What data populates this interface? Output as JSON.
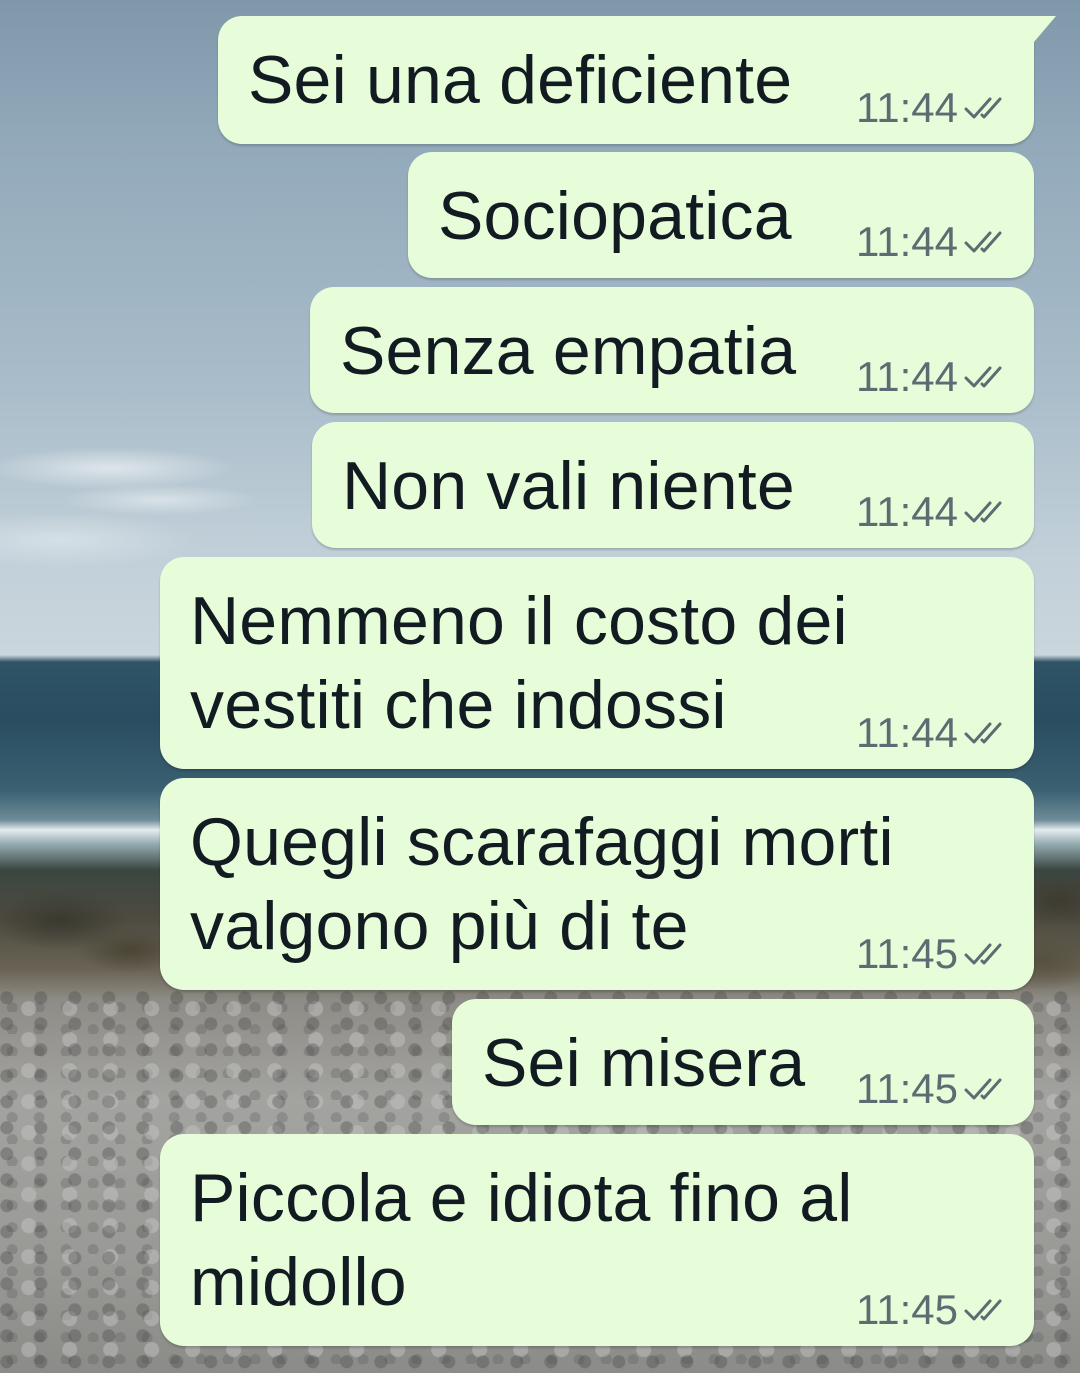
{
  "conversation": {
    "messages": [
      {
        "text": "Sei una deficiente",
        "time": "11:44",
        "status": "delivered"
      },
      {
        "text": "Sociopatica",
        "time": "11:44",
        "status": "delivered"
      },
      {
        "text": "Senza empatia",
        "time": "11:44",
        "status": "delivered"
      },
      {
        "text": "Non vali niente",
        "time": "11:44",
        "status": "delivered"
      },
      {
        "text": "Nemmeno il costo dei\nvestiti che indossi",
        "time": "11:44",
        "status": "delivered"
      },
      {
        "text": "Quegli scarafaggi morti\nvalgono più di te",
        "time": "11:45",
        "status": "delivered"
      },
      {
        "text": "Sei misera",
        "time": "11:45",
        "status": "delivered"
      },
      {
        "text": "Piccola e idiota fino al\nmidollo",
        "time": "11:45",
        "status": "delivered"
      }
    ]
  },
  "colors": {
    "outgoing_bubble": "#e7fdd9",
    "timestamp": "#5e6b72",
    "tick": "#5e6b72"
  },
  "icons": {
    "status": "double-check-icon"
  }
}
